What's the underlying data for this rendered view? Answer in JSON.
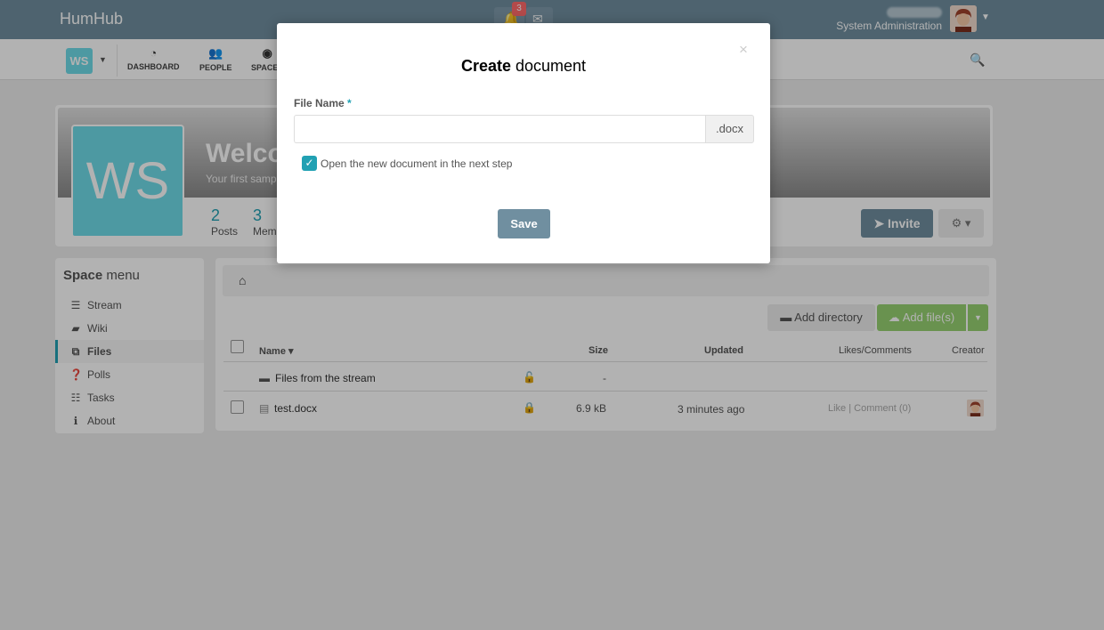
{
  "topbar": {
    "brand": "HumHub",
    "notifications_count": "3",
    "user_role": "System Administration"
  },
  "nav": {
    "space_chip": "WS",
    "items": [
      {
        "label": "DASHBOARD",
        "icon": "dashboard-icon"
      },
      {
        "label": "PEOPLE",
        "icon": "people-icon"
      },
      {
        "label": "SPACES",
        "icon": "spaces-icon"
      }
    ]
  },
  "space": {
    "logo_text": "WS",
    "title": "Welco",
    "subtitle": "Your first samp",
    "stats": [
      {
        "num": "2",
        "label": "Posts"
      },
      {
        "num": "3",
        "label": "Mem"
      }
    ],
    "invite_label": "Invite"
  },
  "menu": {
    "title_bold": "Space",
    "title_rest": " menu",
    "items": [
      {
        "label": "Stream",
        "icon": "bars-icon"
      },
      {
        "label": "Wiki",
        "icon": "book-icon"
      },
      {
        "label": "Files",
        "icon": "files-icon"
      },
      {
        "label": "Polls",
        "icon": "question-icon"
      },
      {
        "label": "Tasks",
        "icon": "tasks-icon"
      },
      {
        "label": "About",
        "icon": "info-icon"
      }
    ]
  },
  "files": {
    "add_directory": "Add directory",
    "add_files": "Add file(s)",
    "columns": {
      "name": "Name ▾",
      "size": "Size",
      "updated": "Updated",
      "likes": "Likes/Comments",
      "creator": "Creator"
    },
    "rows": [
      {
        "name": "Files from the stream",
        "size": "-",
        "updated": "",
        "likes": ""
      },
      {
        "name": "test.docx",
        "size": "6.9 kB",
        "updated": "3 minutes ago",
        "likes": "Like | Comment (0)"
      }
    ]
  },
  "modal": {
    "title_bold": "Create",
    "title_rest": " document",
    "field_label": "File Name",
    "required_mark": "*",
    "file_value": "",
    "extension": ".docx",
    "open_next_label": "Open the new document in the next step",
    "open_next_checked": true,
    "save_label": "Save"
  }
}
